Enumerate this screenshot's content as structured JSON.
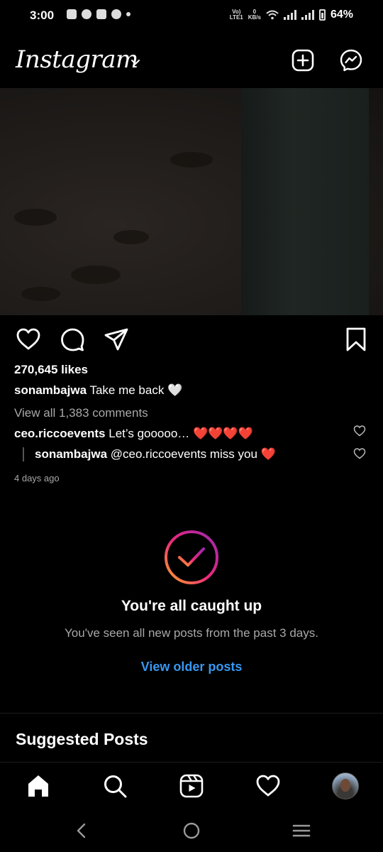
{
  "status_bar": {
    "time": "3:00",
    "volte_label": "Vo)",
    "lte_label": "LTE1",
    "data_speed_value": "0",
    "data_speed_unit": "KB/s",
    "battery": "64%"
  },
  "header": {
    "logo": "Instagram",
    "icons": [
      "chevron-down-icon",
      "new-post-icon",
      "messenger-icon"
    ]
  },
  "post": {
    "likes": "270,645 likes",
    "caption_user": "sonambajwa",
    "caption_text": " Take me back 🤍",
    "view_comments": "View all 1,383 comments",
    "comment_user": "ceo.riccoevents",
    "comment_text": " Let’s gooooo… ❤️❤️❤️❤️",
    "reply_user": "sonambajwa",
    "reply_text": " @ceo.riccoevents miss you ❤️",
    "timestamp": "4 days ago"
  },
  "caught_up": {
    "title": "You're all caught up",
    "subtitle": "You've seen all new posts from the past 3 days.",
    "link": "View older posts",
    "link_color": "#3897f0"
  },
  "suggested": {
    "heading": "Suggested Posts"
  },
  "tabs": [
    "home-icon",
    "search-icon",
    "reels-icon",
    "activity-heart-icon",
    "profile-avatar"
  ]
}
